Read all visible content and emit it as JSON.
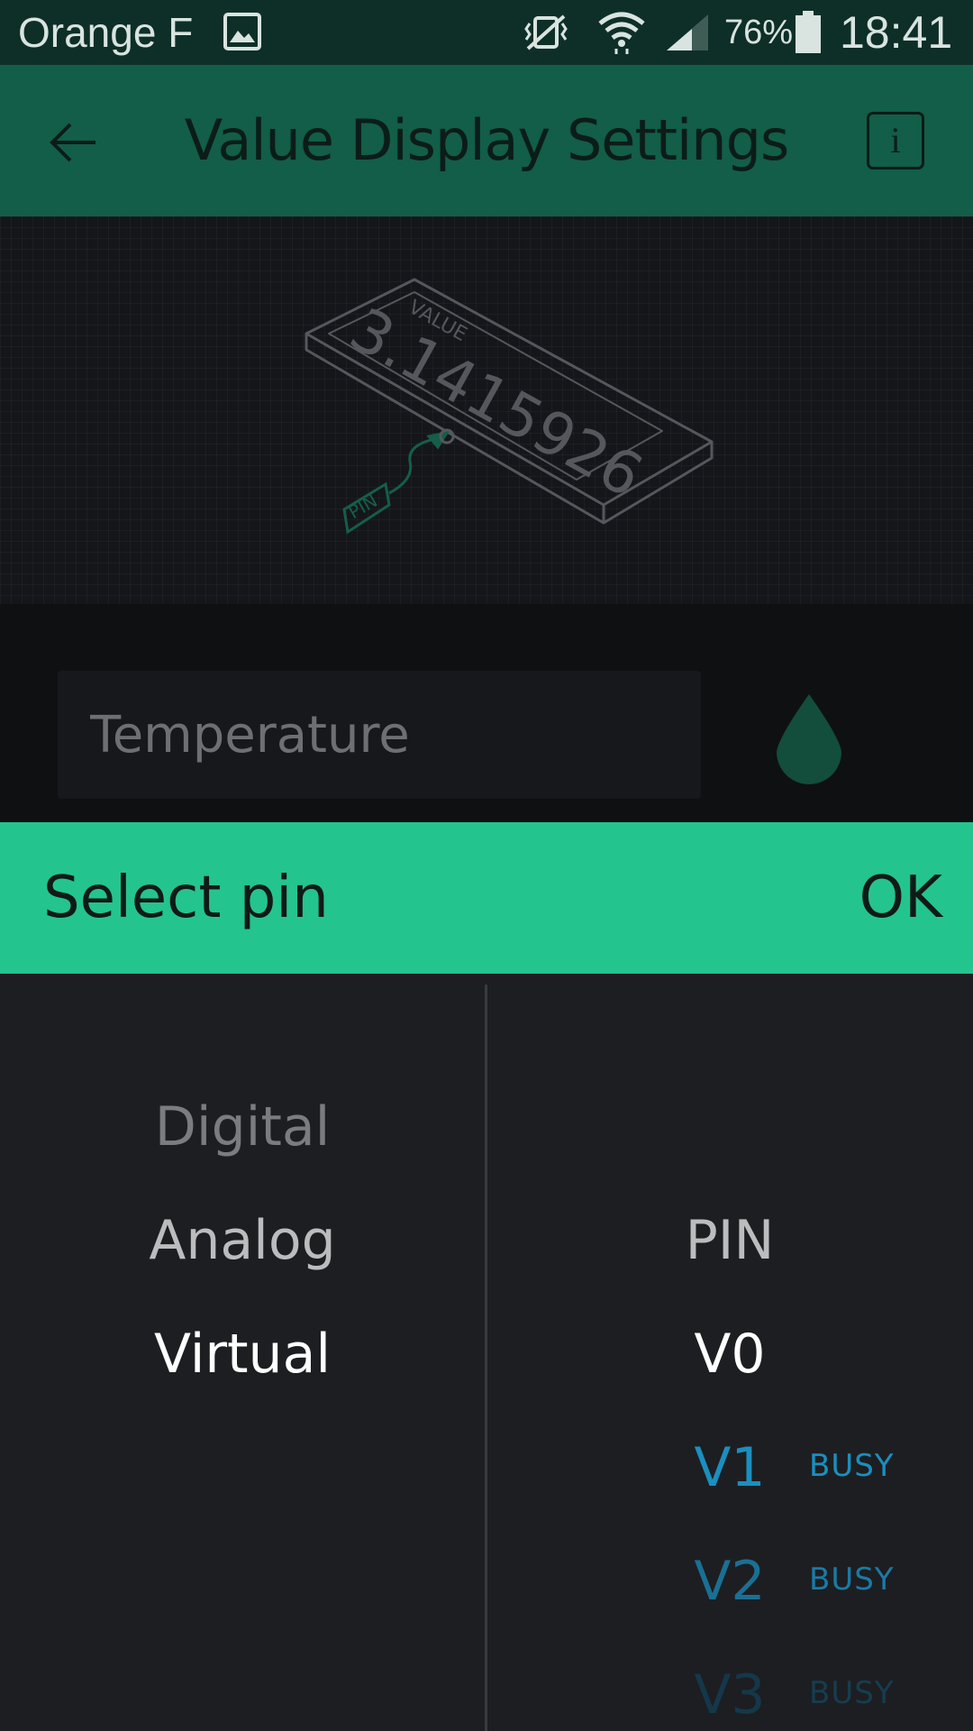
{
  "status_bar": {
    "carrier": "Orange F",
    "battery": "76%",
    "time": "18:41",
    "icons": [
      "gallery-icon",
      "mute-vibrate-icon",
      "wifi-icon",
      "signal-icon",
      "battery-icon"
    ]
  },
  "app_bar": {
    "title": "Value Display Settings",
    "back_icon": "arrow-left-icon",
    "info_label": "i"
  },
  "preview": {
    "value_caption": "VALUE",
    "value_text": "3.1415926",
    "pin_caption": "PIN"
  },
  "name_field": {
    "placeholder": "Temperature",
    "value": ""
  },
  "color": {
    "accent": "#125e48",
    "select_bar": "#24c48e",
    "drop": "#134d3b",
    "busy": "#1a8fc0"
  },
  "select_pin": {
    "title": "Select pin",
    "ok_label": "OK"
  },
  "pin_types": [
    {
      "label": "Digital"
    },
    {
      "label": "Analog"
    },
    {
      "label": "Virtual"
    }
  ],
  "pins": [
    {
      "label": "PIN",
      "busy": ""
    },
    {
      "label": "V0",
      "busy": ""
    },
    {
      "label": "V1",
      "busy": "BUSY"
    },
    {
      "label": "V2",
      "busy": "BUSY"
    },
    {
      "label": "V3",
      "busy": "BUSY"
    }
  ]
}
